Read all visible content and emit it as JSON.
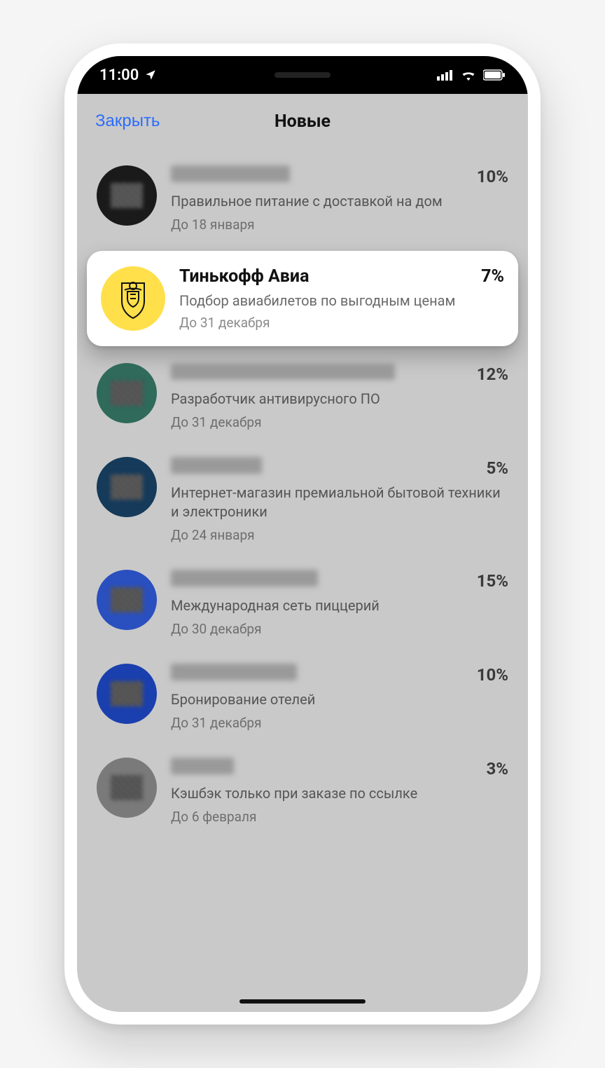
{
  "statusbar": {
    "time": "11:00"
  },
  "header": {
    "close": "Закрыть",
    "title": "Новые"
  },
  "highlight": {
    "name": "Тинькофф Авиа",
    "percent": "7%",
    "desc": "Подбор авиабилетов по выгодным ценам",
    "date": "До 31 декабря",
    "avatar_bg": "#ffe04a"
  },
  "offers": [
    {
      "percent": "10%",
      "desc": "Правильное питание с доставкой на дом",
      "date": "До 18 января",
      "avatar_bg": "#1a1a1a",
      "name_pix_w": 170
    },
    {
      "percent": "12%",
      "desc": "Разработчик антивирусного ПО",
      "date": "До 31 декабря",
      "avatar_bg": "#2f6a5a",
      "name_pix_w": 320
    },
    {
      "percent": "5%",
      "desc": "Интернет-магазин премиальной бытовой техники и электроники",
      "date": "До 24 января",
      "avatar_bg": "#153a5a",
      "name_pix_w": 130
    },
    {
      "percent": "15%",
      "desc": "Международная сеть пиццерий",
      "date": "До 30 декабря",
      "avatar_bg": "#2a4fbf",
      "name_pix_w": 210
    },
    {
      "percent": "10%",
      "desc": "Бронирование отелей",
      "date": "До 31 декабря",
      "avatar_bg": "#1a3fae",
      "name_pix_w": 180
    },
    {
      "percent": "3%",
      "desc": "Кэшбэк только при заказе по ссылке",
      "date": "До 6 февраля",
      "avatar_bg": "#7a7a7a",
      "name_pix_w": 90
    }
  ]
}
